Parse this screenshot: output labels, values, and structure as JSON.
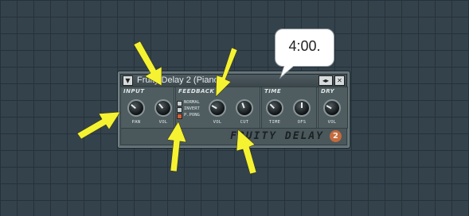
{
  "plugin": {
    "title": "Fruity Delay 2 (Piano)",
    "brand": "FRUITY DELAY",
    "brand_number": "2",
    "sections": {
      "input": "INPUT",
      "feedback": "FEEDBACK",
      "time": "TIME",
      "dry": "DRY"
    },
    "knob_labels": {
      "input_pan": "PAN",
      "input_vol": "VOL",
      "feedback_vol": "VOL",
      "feedback_cut": "CUT",
      "time_time": "TIME",
      "time_ofs": "OFS",
      "dry_vol": "VOL"
    },
    "modes": [
      {
        "label": "NORMAL",
        "selected": false
      },
      {
        "label": "INVERT",
        "selected": false
      },
      {
        "label": "P.PONG",
        "selected": true
      }
    ]
  },
  "callout": {
    "text": "4:00."
  },
  "colors": {
    "arrow": "#f5f232",
    "background": "#34424c",
    "plugin_body": "#5c6c71"
  },
  "icons": {
    "menu": "triangle-down",
    "nav": "left-right-arrows",
    "close": "x"
  }
}
